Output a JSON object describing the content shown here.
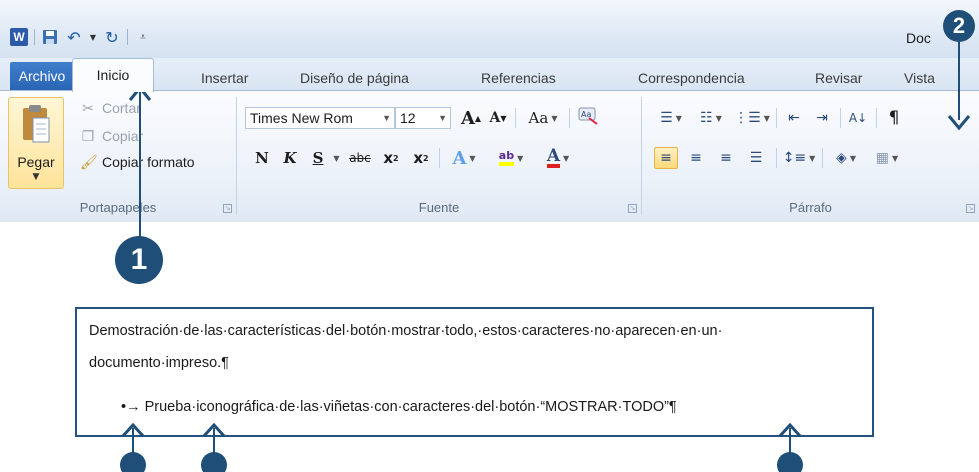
{
  "window": {
    "app_icon": "word-icon",
    "title": "Doc",
    "quick_access": [
      "save-icon",
      "undo-icon",
      "undo-dropdown-icon",
      "redo-icon",
      "customize-qat-icon"
    ]
  },
  "tabs": [
    {
      "label": "Archivo"
    },
    {
      "label": "Inicio"
    },
    {
      "label": "Insertar"
    },
    {
      "label": "Diseño de página"
    },
    {
      "label": "Referencias"
    },
    {
      "label": "Correspondencia"
    },
    {
      "label": "Revisar"
    },
    {
      "label": "Vista"
    }
  ],
  "groups": {
    "clipboard": {
      "label": "Portapapeles",
      "paste_label": "Pegar",
      "cut_label": "Cortar",
      "copy_label": "Copiar",
      "format_painter_label": "Copiar formato"
    },
    "font": {
      "label": "Fuente",
      "font_name": "Times New Rom",
      "font_size": "12",
      "grow_font": "A",
      "shrink_font": "A",
      "change_case": "Aa",
      "bold": "N",
      "italic": "K",
      "underline": "S",
      "strikethrough": "abc",
      "subscript": "x",
      "superscript": "x",
      "text_effects": "A",
      "highlight": "ab",
      "font_color": "A"
    },
    "paragraph": {
      "label": "Párrafo",
      "show_all": "¶"
    }
  },
  "callouts": {
    "one": "1",
    "two": "2"
  },
  "demo": {
    "line1": "Demostración·de·las·características·del·botón·mostrar·todo,·estos·caracteres·no·aparecen·en·un·",
    "line2": "documento·impreso.¶",
    "bullet_line": "•→ Prueba·iconográfica·de·las·viñetas·con·caracteres·del·botón·“MOSTRAR·TODO”¶"
  },
  "colors": {
    "accent": "#1f4e79",
    "file_tab": "#2a65b5",
    "paste_highlight": "#ffe39a",
    "highlight_yellow": "#ffff00",
    "font_red": "#e02020"
  }
}
